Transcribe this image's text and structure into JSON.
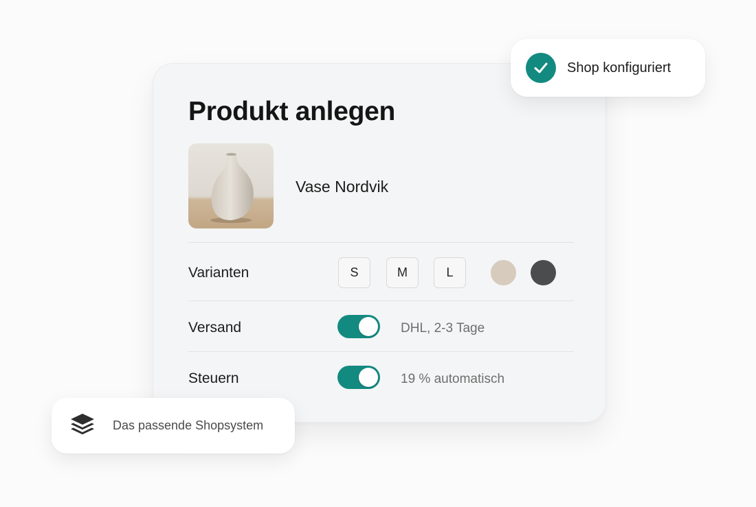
{
  "card": {
    "title": "Produkt anlegen",
    "product": {
      "name": "Vase Nordvik",
      "image_icon": "vase-photo"
    },
    "variants": {
      "label": "Varianten",
      "sizes": [
        "S",
        "M",
        "L"
      ],
      "colors": [
        "#d6cbbd",
        "#4b4c4e"
      ]
    },
    "shipping": {
      "label": "Versand",
      "enabled": true,
      "note": "DHL, 2-3 Tage"
    },
    "taxes": {
      "label": "Steuern",
      "enabled": true,
      "note": "19 % automatisch"
    }
  },
  "badge_top": {
    "text": "Shop konfiguriert",
    "icon": "check-icon",
    "accent": "#138a80"
  },
  "badge_bottom": {
    "text": "Das passende Shopsystem",
    "icon": "layers-icon"
  }
}
